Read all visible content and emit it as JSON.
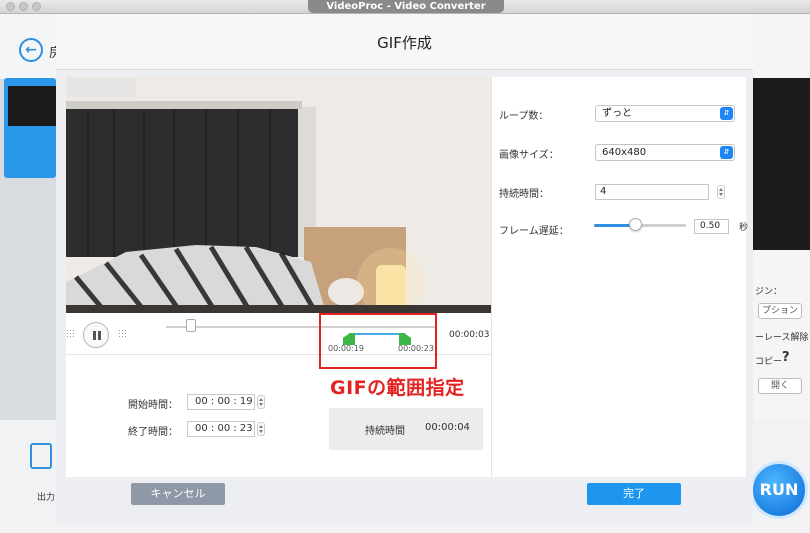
{
  "window": {
    "title": "VideoProc - Video Converter"
  },
  "background": {
    "back_label": "房",
    "output_label": "出力",
    "right_panel": {
      "engine_label": "ジン：",
      "option_button": "プション",
      "deinterlace_label": "ーレース解除",
      "copy_label": "コピー",
      "help_icon": "?",
      "open_button": "開く"
    },
    "run_label": "RUN"
  },
  "dialog": {
    "title": "GIF作成",
    "player": {
      "current_time": "00:00:03",
      "range_start": "00:00:19",
      "range_end": "00:00:23"
    },
    "annotation": "GIFの範囲指定",
    "start_time": {
      "label": "開始時間：",
      "value": "00 : 00 : 19"
    },
    "end_time": {
      "label": "終了時間：",
      "value": "00 : 00 : 23"
    },
    "duration": {
      "label": "持続時間",
      "value": "00:00:04"
    },
    "settings": {
      "loop_count": {
        "label": "ループ数：",
        "value": "ずっと"
      },
      "image_size": {
        "label": "画像サイズ：",
        "value": "640x480"
      },
      "duration_time": {
        "label": "持続時間：",
        "value": "4"
      },
      "frame_delay": {
        "label": "フレーム遅延：",
        "value": "0.50",
        "unit": "秒",
        "level": 0.5
      }
    },
    "buttons": {
      "cancel": "キャンセル",
      "done": "完了"
    }
  },
  "colors": {
    "accent": "#1e95ef",
    "annotation": "#e32222",
    "range_handle": "#3cb645"
  }
}
